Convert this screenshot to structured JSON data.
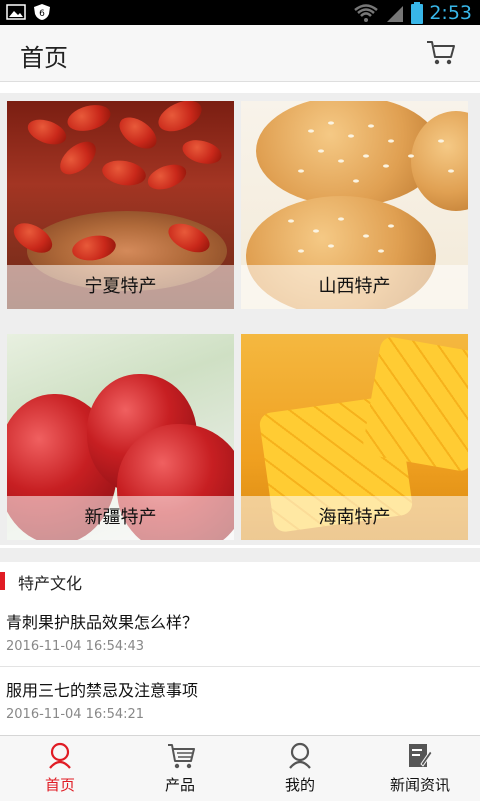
{
  "status_bar": {
    "time": "2:53"
  },
  "header": {
    "title": "首页"
  },
  "categories": [
    {
      "label": "宁夏特产"
    },
    {
      "label": "山西特产"
    },
    {
      "label": "新疆特产"
    },
    {
      "label": "海南特产"
    }
  ],
  "section": {
    "title": "特产文化"
  },
  "news": [
    {
      "title": "青刺果护肤品效果怎么样？",
      "date": "2016-11-04 16:54:43"
    },
    {
      "title": "服用三七的禁忌及注意事项",
      "date": "2016-11-04 16:54:21"
    }
  ],
  "tabs": [
    {
      "label": "首页",
      "active": true
    },
    {
      "label": "产品",
      "active": false
    },
    {
      "label": "我的",
      "active": false
    },
    {
      "label": "新闻资讯",
      "active": false
    }
  ],
  "colors": {
    "accent": "#e01c24",
    "time": "#38b6e8"
  }
}
